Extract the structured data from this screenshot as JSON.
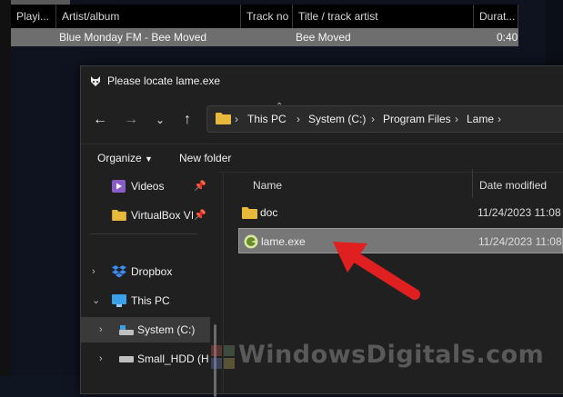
{
  "player": {
    "columns": [
      "Playi...",
      "Artist/album",
      "Track no",
      "Title / track artist",
      "Durat..."
    ],
    "row": {
      "artist_album": "Blue Monday FM - Bee Moved",
      "title": "Bee Moved",
      "duration": "0:40"
    }
  },
  "dialog": {
    "title": "Please locate lame.exe",
    "breadcrumb": [
      "This PC",
      "System (C:)",
      "Program Files",
      "Lame"
    ],
    "commands": {
      "organize": "Organize",
      "new_folder": "New folder"
    },
    "nav_pane": [
      {
        "label": "Videos",
        "icon": "videos-icon",
        "pinned": true
      },
      {
        "label": "VirtualBox VI",
        "icon": "folder-icon",
        "pinned": true
      },
      {
        "label": "Dropbox",
        "icon": "dropbox-icon",
        "expander": true
      },
      {
        "label": "This PC",
        "icon": "computer-icon",
        "expander": true,
        "expanded": true
      },
      {
        "label": "System (C:)",
        "icon": "drive-icon",
        "expander": true,
        "selected": true
      },
      {
        "label": "Small_HDD (H:",
        "icon": "drive-icon",
        "expander": true
      }
    ],
    "columns": {
      "name": "Name",
      "date": "Date modified"
    },
    "files": [
      {
        "name": "doc",
        "icon": "folder-icon",
        "date": "11/24/2023 11:08"
      },
      {
        "name": "lame.exe",
        "icon": "lame-exe-icon",
        "date": "11/24/2023 11:08",
        "selected": true
      }
    ]
  },
  "watermark": {
    "text": "WindowsDigitals.com"
  },
  "colors": {
    "selection": "#777777",
    "arrow": "#e02020",
    "folder": "#e8b83a"
  }
}
